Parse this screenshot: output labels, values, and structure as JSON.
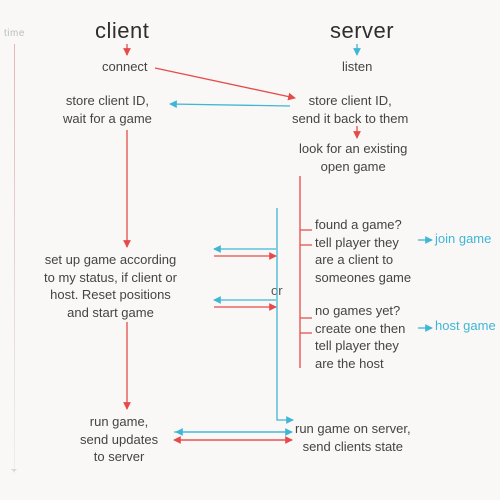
{
  "axis_label": "time",
  "headers": {
    "client": "client",
    "server": "server"
  },
  "nodes": {
    "c_connect": "connect",
    "s_listen": "listen",
    "c_store": "store client ID,\nwait for a game",
    "s_store": "store client ID,\nsend it back to them",
    "s_look": "look for an existing\nopen game",
    "s_found": "found a game?\ntell player they\nare a client to\nsomeones game",
    "s_none": "no games yet?\ncreate one then\ntell player they\nare the host",
    "c_setup": "set up game according\nto my status, if client or\nhost. Reset positions\nand start game",
    "c_run": "run game,\nsend updates\nto server",
    "s_run": "run game on server,\nsend clients state",
    "or": "or"
  },
  "labels": {
    "join": "join\ngame",
    "host": "host\ngame"
  },
  "colors": {
    "red": "#e54b4b",
    "blue": "#3fb6d6"
  },
  "chart_data": {
    "type": "diagram",
    "title": "Client–server game setup sequence",
    "lanes": [
      "client",
      "server"
    ],
    "time_axis": "top-to-bottom",
    "steps": [
      {
        "lane": "client",
        "id": "c_connect",
        "text": "connect"
      },
      {
        "lane": "server",
        "id": "s_listen",
        "text": "listen"
      },
      {
        "lane": "server",
        "id": "s_store",
        "text": "store client ID, send it back to them"
      },
      {
        "lane": "client",
        "id": "c_store",
        "text": "store client ID, wait for a game"
      },
      {
        "lane": "server",
        "id": "s_look",
        "text": "look for an existing open game"
      },
      {
        "lane": "server",
        "id": "s_found",
        "branch": "or",
        "text": "found a game? tell player they are a client to someones game",
        "label": "join game"
      },
      {
        "lane": "server",
        "id": "s_none",
        "branch": "or",
        "text": "no games yet? create one then tell player they are the host",
        "label": "host game"
      },
      {
        "lane": "client",
        "id": "c_setup",
        "text": "set up game according to my status, if client or host. Reset positions and start game"
      },
      {
        "lane": "client",
        "id": "c_run",
        "text": "run game, send updates to server"
      },
      {
        "lane": "server",
        "id": "s_run",
        "text": "run game on server, send clients state"
      }
    ],
    "messages": [
      {
        "from": "c_connect",
        "to": "s_store",
        "color": "red"
      },
      {
        "from": "s_store",
        "to": "c_store",
        "color": "blue"
      },
      {
        "from": "s_found",
        "to": "c_setup",
        "color": "blue",
        "note": "join game"
      },
      {
        "from": "s_none",
        "to": "c_setup",
        "color": "blue",
        "note": "host game"
      },
      {
        "from": "c_setup",
        "to": "s_run",
        "color": "red"
      },
      {
        "from": "c_run",
        "to": "s_run",
        "color": "red",
        "bidir": true
      }
    ]
  }
}
